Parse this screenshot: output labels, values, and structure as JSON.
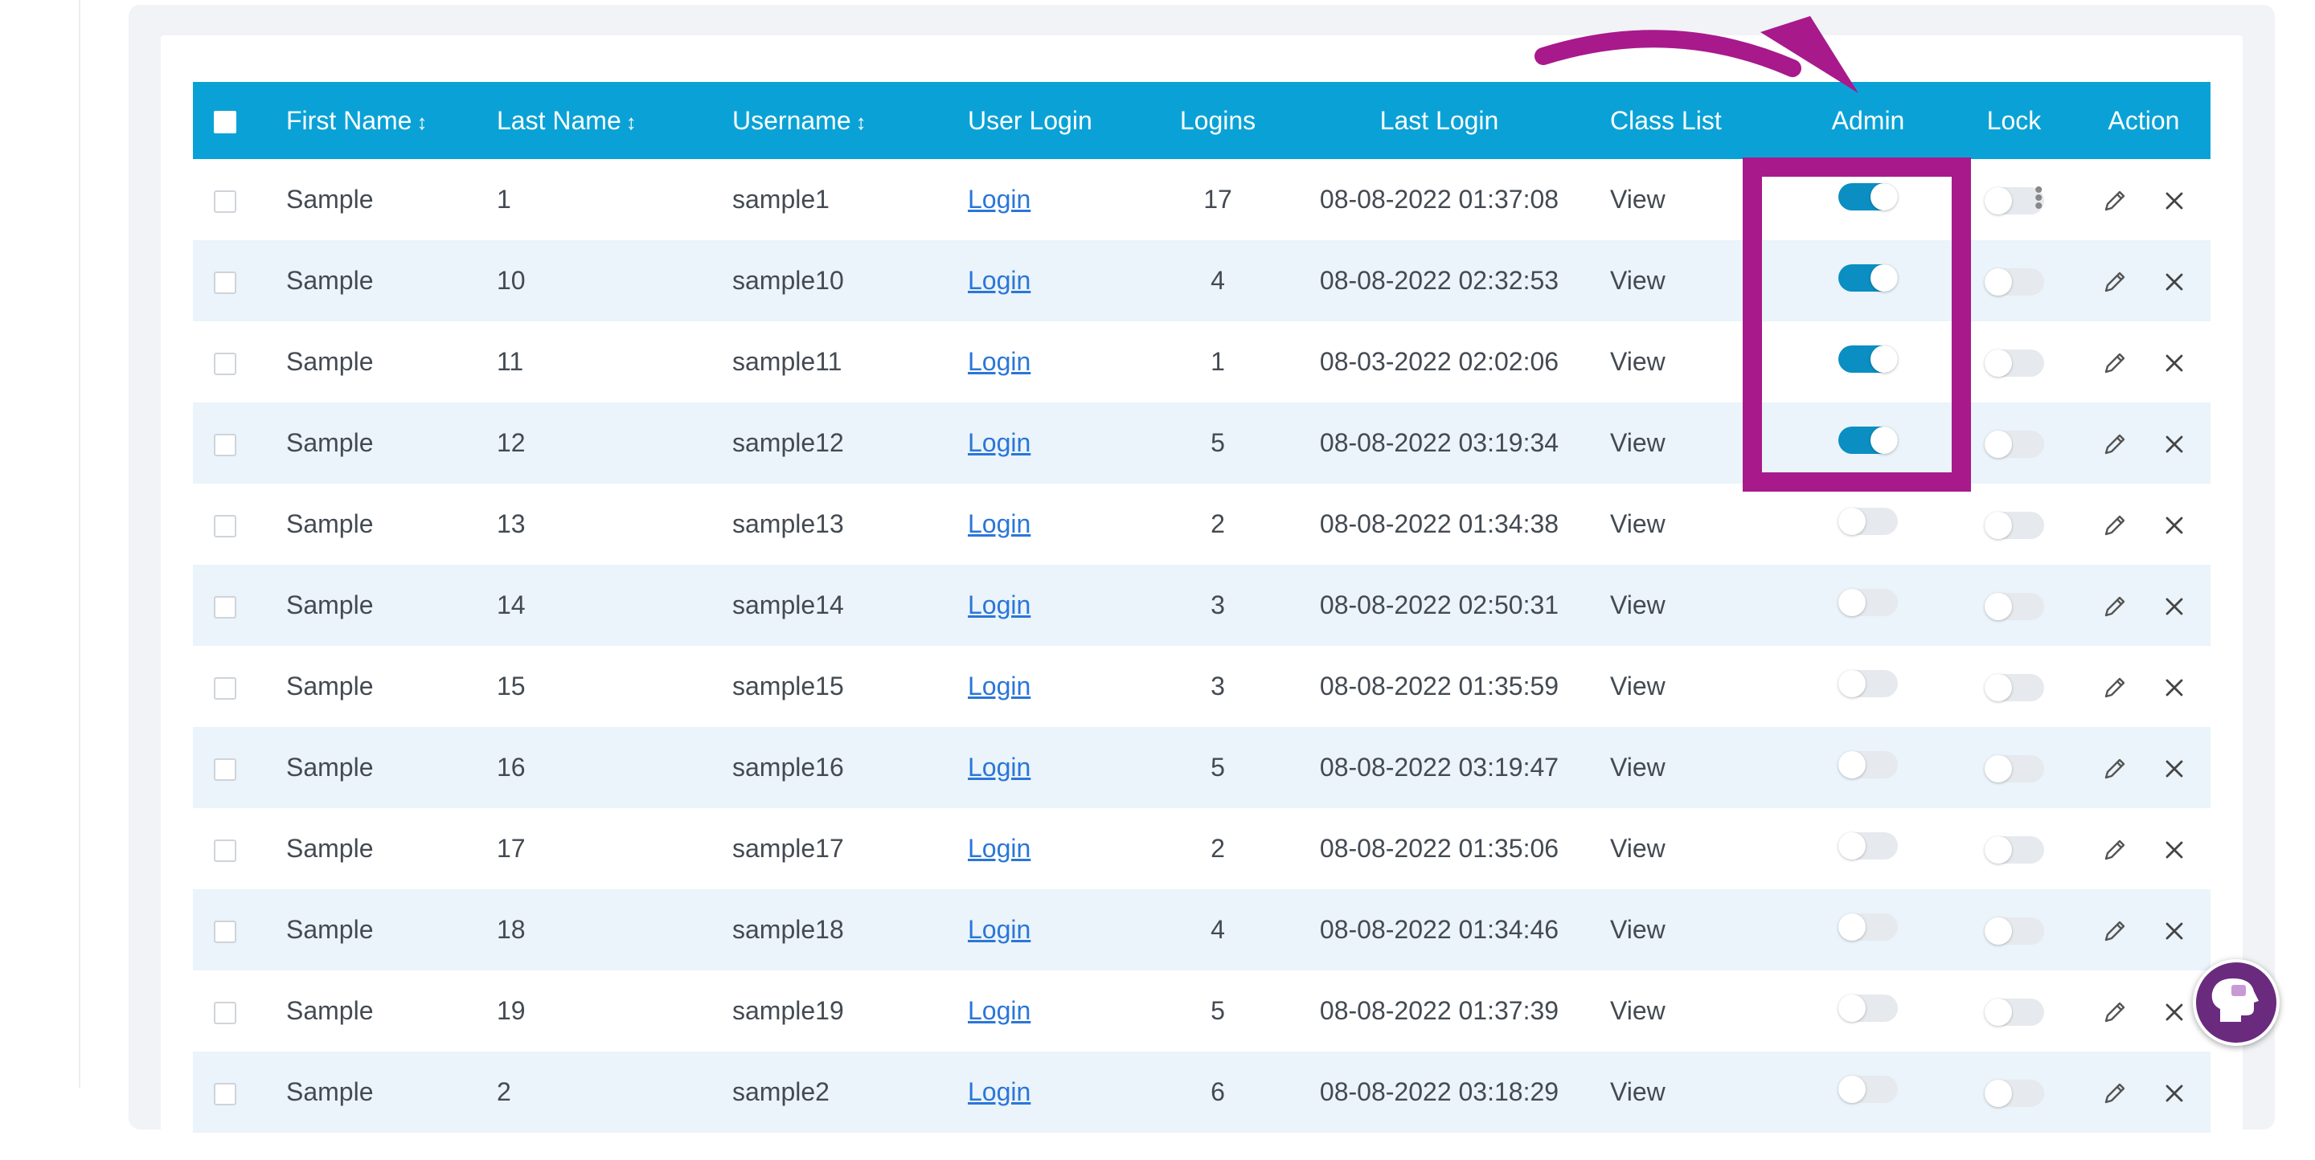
{
  "table": {
    "columns": [
      {
        "label": "First Name",
        "sortable": true
      },
      {
        "label": "Last Name",
        "sortable": true
      },
      {
        "label": "Username",
        "sortable": true
      },
      {
        "label": "User Login",
        "sortable": false
      },
      {
        "label": "Logins",
        "sortable": false
      },
      {
        "label": "Last Login",
        "sortable": false
      },
      {
        "label": "Class List",
        "sortable": false
      },
      {
        "label": "Admin",
        "sortable": false
      },
      {
        "label": "Lock",
        "sortable": false
      },
      {
        "label": "Action",
        "sortable": false
      }
    ],
    "sort_glyph": "↕",
    "rows": [
      {
        "first_name": "Sample",
        "last_name": "1",
        "username": "sample1",
        "login_link": "Login",
        "logins": "17",
        "last_login": "08-08-2022 01:37:08",
        "class_list": "View",
        "admin": true,
        "lock": false
      },
      {
        "first_name": "Sample",
        "last_name": "10",
        "username": "sample10",
        "login_link": "Login",
        "logins": "4",
        "last_login": "08-08-2022 02:32:53",
        "class_list": "View",
        "admin": true,
        "lock": false
      },
      {
        "first_name": "Sample",
        "last_name": "11",
        "username": "sample11",
        "login_link": "Login",
        "logins": "1",
        "last_login": "08-03-2022 02:02:06",
        "class_list": "View",
        "admin": true,
        "lock": false
      },
      {
        "first_name": "Sample",
        "last_name": "12",
        "username": "sample12",
        "login_link": "Login",
        "logins": "5",
        "last_login": "08-08-2022 03:19:34",
        "class_list": "View",
        "admin": true,
        "lock": false
      },
      {
        "first_name": "Sample",
        "last_name": "13",
        "username": "sample13",
        "login_link": "Login",
        "logins": "2",
        "last_login": "08-08-2022 01:34:38",
        "class_list": "View",
        "admin": false,
        "lock": false
      },
      {
        "first_name": "Sample",
        "last_name": "14",
        "username": "sample14",
        "login_link": "Login",
        "logins": "3",
        "last_login": "08-08-2022 02:50:31",
        "class_list": "View",
        "admin": false,
        "lock": false
      },
      {
        "first_name": "Sample",
        "last_name": "15",
        "username": "sample15",
        "login_link": "Login",
        "logins": "3",
        "last_login": "08-08-2022 01:35:59",
        "class_list": "View",
        "admin": false,
        "lock": false
      },
      {
        "first_name": "Sample",
        "last_name": "16",
        "username": "sample16",
        "login_link": "Login",
        "logins": "5",
        "last_login": "08-08-2022 03:19:47",
        "class_list": "View",
        "admin": false,
        "lock": false
      },
      {
        "first_name": "Sample",
        "last_name": "17",
        "username": "sample17",
        "login_link": "Login",
        "logins": "2",
        "last_login": "08-08-2022 01:35:06",
        "class_list": "View",
        "admin": false,
        "lock": false
      },
      {
        "first_name": "Sample",
        "last_name": "18",
        "username": "sample18",
        "login_link": "Login",
        "logins": "4",
        "last_login": "08-08-2022 01:34:46",
        "class_list": "View",
        "admin": false,
        "lock": false
      },
      {
        "first_name": "Sample",
        "last_name": "19",
        "username": "sample19",
        "login_link": "Login",
        "logins": "5",
        "last_login": "08-08-2022 01:37:39",
        "class_list": "View",
        "admin": false,
        "lock": false
      },
      {
        "first_name": "Sample",
        "last_name": "2",
        "username": "sample2",
        "login_link": "Login",
        "logins": "6",
        "last_login": "08-08-2022 03:18:29",
        "class_list": "View",
        "admin": false,
        "lock": false
      }
    ]
  },
  "icons": {
    "edit": "pencil-icon",
    "delete": "close-icon",
    "row_menu": "more-vertical-icon",
    "help": "help-chat-icon"
  },
  "colors": {
    "header_bg": "#0aa2d6",
    "toggle_on": "#0b8ec2",
    "annotation": "#a8198c",
    "link": "#2b76d8",
    "striped_row": "#eaf4fa"
  }
}
